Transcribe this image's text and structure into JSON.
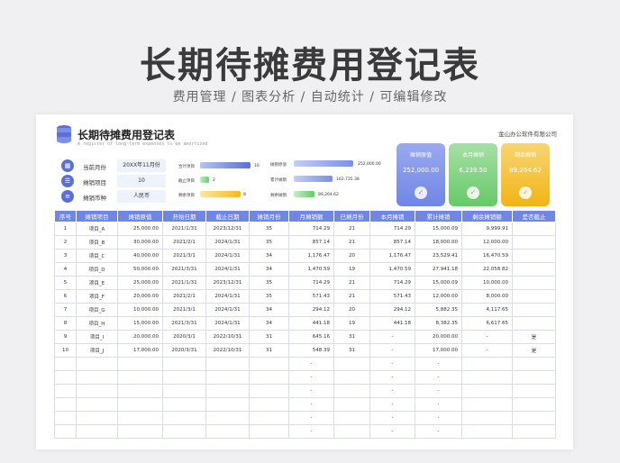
{
  "hero": {
    "title": "长期待摊费用登记表",
    "subtitle": "费用管理 / 图表分析 / 自动统计 / 可编辑修改"
  },
  "sheet": {
    "title": "长期待摊费用登记表",
    "subtitle": "A register of long-term expenses to be amortized",
    "company": "金山办公软件有限公司"
  },
  "info": {
    "month_label": "当前月份",
    "month_value": "20XX年11月份",
    "count_label": "摊销项目",
    "count_value": "10",
    "currency_label": "摊销币种",
    "currency_value": "人民币"
  },
  "mini": {
    "total_label": "合计项目",
    "total_value": "10",
    "ended_label": "截止项目",
    "ended_value": "2",
    "remain_label": "剩余项目",
    "remain_value": "8",
    "original_label": "摊销原值",
    "original_value": "252,000.00",
    "accum_label": "累计摊销",
    "accum_value": "162,735.38",
    "remain_amort_label": "剩余摊销",
    "remain_amort_value": "89,264.62"
  },
  "cards": [
    {
      "label": "摊销原值",
      "value": "252,000.00",
      "color": "#7b8fe8"
    },
    {
      "label": "本月摊销",
      "value": "6,239.50",
      "color": "#7fd17f"
    },
    {
      "label": "剩余摊销",
      "value": "89,264.62",
      "color": "#f5c23e"
    }
  ],
  "table": {
    "headers": [
      "序号",
      "摊销项目",
      "摊销原值",
      "开始日期",
      "截止日期",
      "摊销月份",
      "月摊销额",
      "已摊月份",
      "本月摊销",
      "累计摊销",
      "剩余摊销额",
      "是否截止"
    ],
    "rows": [
      [
        "1",
        "项目_A",
        "25,000.00",
        "2021/1/31",
        "2023/12/31",
        "35",
        "714.29",
        "21",
        "714.29",
        "15,000.09",
        "9,999.91",
        ""
      ],
      [
        "2",
        "项目_B",
        "30,000.00",
        "2021/2/1",
        "2024/1/31",
        "35",
        "857.14",
        "21",
        "857.14",
        "18,000.00",
        "12,000.00",
        ""
      ],
      [
        "3",
        "项目_C",
        "40,000.00",
        "2021/3/1",
        "2024/1/31",
        "34",
        "1,176.47",
        "20",
        "1,176.47",
        "23,529.41",
        "16,470.59",
        ""
      ],
      [
        "4",
        "项目_D",
        "50,000.00",
        "2021/3/31",
        "2024/1/31",
        "34",
        "1,470.59",
        "19",
        "1,470.59",
        "27,941.18",
        "22,058.82",
        ""
      ],
      [
        "5",
        "项目_E",
        "25,000.00",
        "2021/1/31",
        "2023/12/31",
        "35",
        "714.29",
        "21",
        "714.29",
        "15,000.09",
        "10,000.00",
        ""
      ],
      [
        "6",
        "项目_F",
        "20,000.00",
        "2021/2/1",
        "2024/1/31",
        "35",
        "571.43",
        "21",
        "571.43",
        "12,000.00",
        "8,000.00",
        ""
      ],
      [
        "7",
        "项目_G",
        "10,000.00",
        "2021/3/1",
        "2024/1/31",
        "34",
        "294.12",
        "20",
        "294.12",
        "5,882.35",
        "4,117.65",
        ""
      ],
      [
        "8",
        "项目_H",
        "15,000.00",
        "2021/3/31",
        "2024/1/31",
        "34",
        "441.18",
        "19",
        "441.18",
        "8,382.35",
        "6,617.65",
        ""
      ],
      [
        "9",
        "项目_I",
        "20,000.00",
        "2020/3/1",
        "2022/10/31",
        "31",
        "645.16",
        "31",
        "-",
        "20,000.00",
        "-",
        "是"
      ],
      [
        "10",
        "项目_J",
        "17,000.00",
        "2020/3/31",
        "2022/10/31",
        "31",
        "548.39",
        "31",
        "-",
        "17,000.00",
        "-",
        "是"
      ],
      [
        "",
        "",
        "",
        "",
        "",
        "",
        "-",
        "",
        "-",
        "-",
        "",
        ""
      ],
      [
        "",
        "",
        "",
        "",
        "",
        "",
        "-",
        "",
        "-",
        "-",
        "",
        ""
      ],
      [
        "",
        "",
        "",
        "",
        "",
        "",
        "-",
        "",
        "-",
        "-",
        "",
        ""
      ],
      [
        "",
        "",
        "",
        "",
        "",
        "",
        "-",
        "",
        "-",
        "-",
        "",
        ""
      ],
      [
        "",
        "",
        "",
        "",
        "",
        "",
        "-",
        "",
        "-",
        "-",
        "",
        ""
      ],
      [
        "",
        "",
        "",
        "",
        "",
        "",
        "-",
        "",
        "-",
        "-",
        "",
        ""
      ]
    ]
  }
}
